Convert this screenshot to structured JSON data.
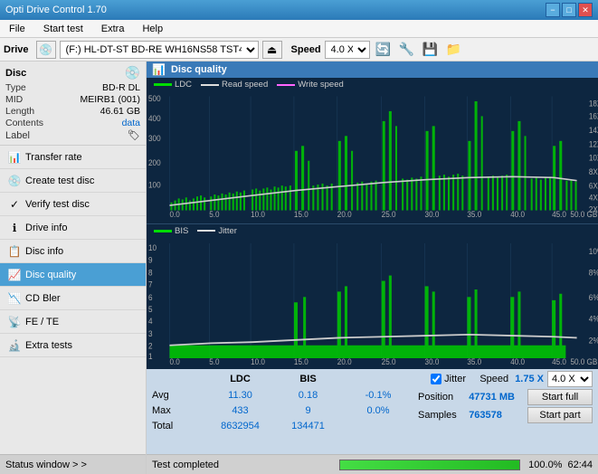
{
  "titlebar": {
    "title": "Opti Drive Control 1.70",
    "min_label": "−",
    "max_label": "□",
    "close_label": "✕"
  },
  "menubar": {
    "items": [
      "File",
      "Start test",
      "Extra",
      "Help"
    ]
  },
  "drivebar": {
    "label": "Drive",
    "drive_value": "(F:)  HL-DT-ST BD-RE  WH16NS58 TST4",
    "speed_label": "Speed",
    "speed_value": "4.0 X"
  },
  "disc": {
    "label": "Disc",
    "type_label": "Type",
    "type_value": "BD-R DL",
    "mid_label": "MID",
    "mid_value": "MEIRB1 (001)",
    "length_label": "Length",
    "length_value": "46.61 GB",
    "contents_label": "Contents",
    "contents_value": "data",
    "label_label": "Label"
  },
  "sidebar": {
    "items": [
      {
        "id": "transfer-rate",
        "label": "Transfer rate",
        "icon": "📊"
      },
      {
        "id": "create-test-disc",
        "label": "Create test disc",
        "icon": "💿"
      },
      {
        "id": "verify-test-disc",
        "label": "Verify test disc",
        "icon": "✓"
      },
      {
        "id": "drive-info",
        "label": "Drive info",
        "icon": "ℹ"
      },
      {
        "id": "disc-info",
        "label": "Disc info",
        "icon": "📋"
      },
      {
        "id": "disc-quality",
        "label": "Disc quality",
        "icon": "📈",
        "active": true
      },
      {
        "id": "cd-bler",
        "label": "CD Bler",
        "icon": "📉"
      },
      {
        "id": "fe-te",
        "label": "FE / TE",
        "icon": "📡"
      },
      {
        "id": "extra-tests",
        "label": "Extra tests",
        "icon": "🔬"
      }
    ]
  },
  "status_window": {
    "label": "Status window > >"
  },
  "disc_quality": {
    "title": "Disc quality",
    "legend": [
      {
        "label": "LDC",
        "color": "#00cc00"
      },
      {
        "label": "Read speed",
        "color": "#ffffff"
      },
      {
        "label": "Write speed",
        "color": "#ff66ff"
      }
    ],
    "legend2": [
      {
        "label": "BIS",
        "color": "#00cc00"
      },
      {
        "label": "Jitter",
        "color": "#ffffff"
      }
    ]
  },
  "stats": {
    "col_ldc": "LDC",
    "col_bis": "BIS",
    "jitter_label": "Jitter",
    "speed_label": "Speed",
    "speed_val1": "1.75 X",
    "speed_val2": "4.0 X",
    "rows": [
      {
        "label": "Avg",
        "ldc": "11.30",
        "bis": "0.18",
        "jitter": "-0.1%"
      },
      {
        "label": "Max",
        "ldc": "433",
        "bis": "9",
        "jitter": "0.0%"
      },
      {
        "label": "Total",
        "ldc": "8632954",
        "bis": "134471",
        "jitter": ""
      }
    ],
    "position_label": "Position",
    "position_val": "47731 MB",
    "samples_label": "Samples",
    "samples_val": "763578",
    "start_full_label": "Start full",
    "start_part_label": "Start part"
  },
  "bottom": {
    "status_text": "Test completed",
    "progress_pct": 100,
    "progress_display": "100.0%",
    "time": "62:44"
  },
  "colors": {
    "chart_bg": "#0a1f3a",
    "ldc_bar": "#00dd00",
    "read_speed": "#dddddd",
    "bis_bar": "#00dd00",
    "accent_blue": "#4a9fd4"
  }
}
